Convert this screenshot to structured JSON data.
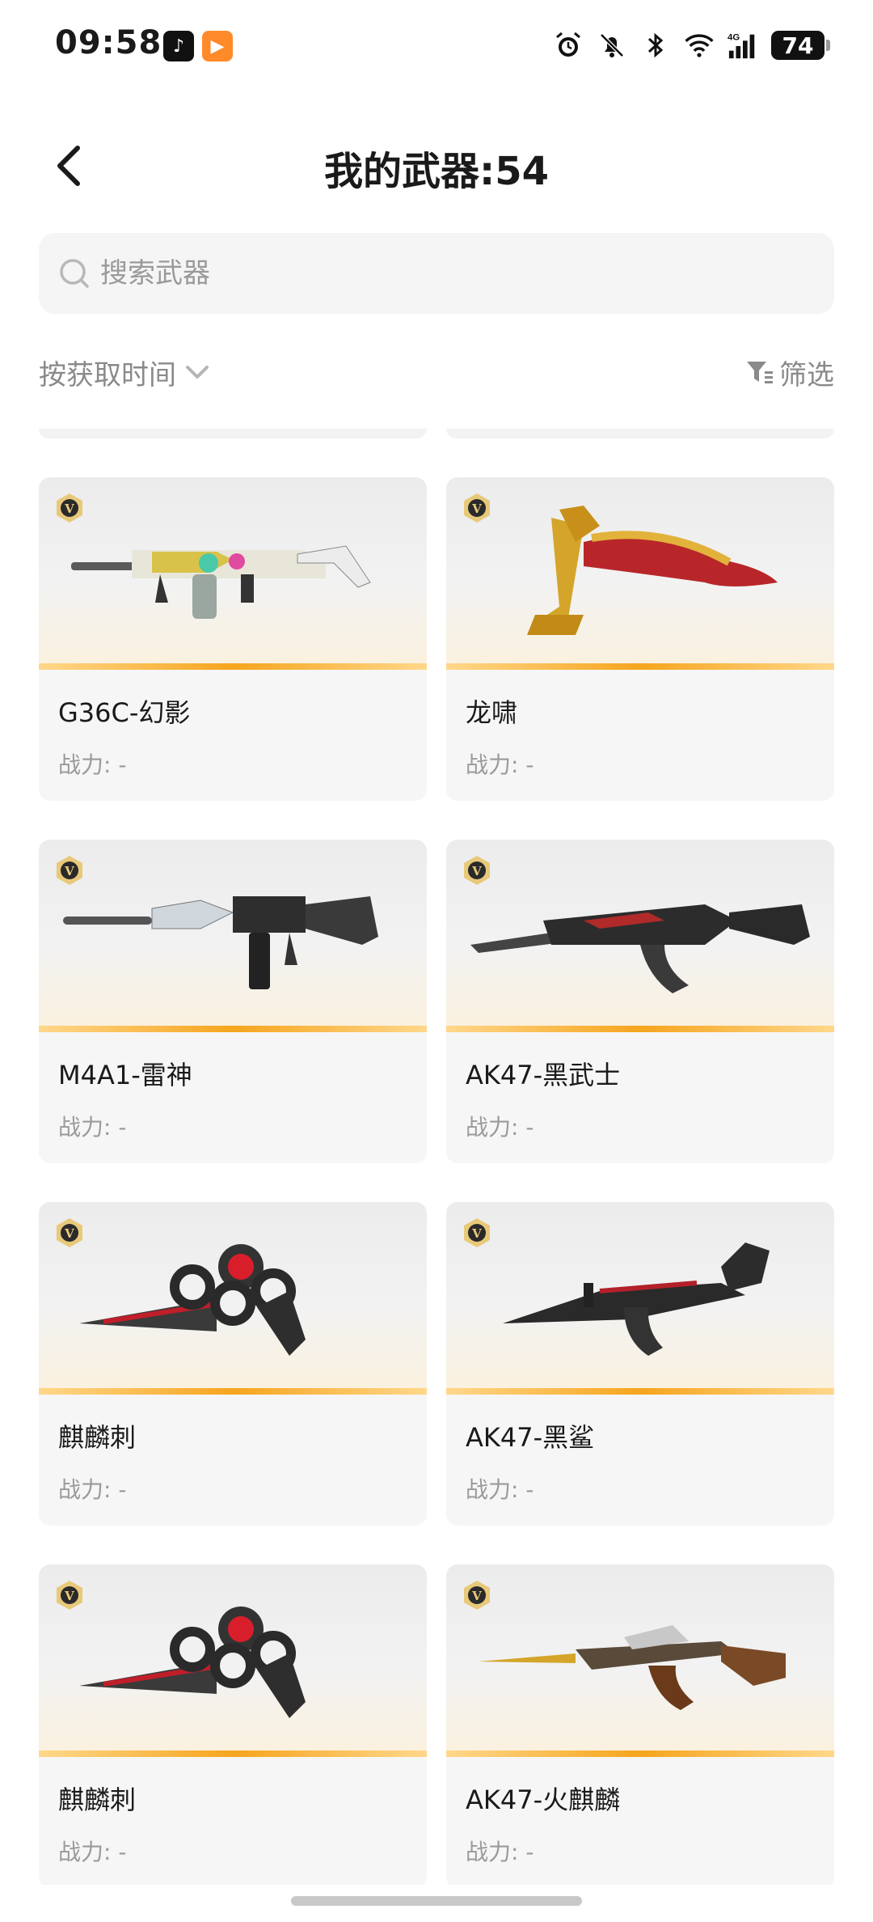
{
  "status_bar": {
    "time": "09:58",
    "battery": "74",
    "icons": [
      "tiktok-app-icon",
      "video-app-icon",
      "alarm-icon",
      "bell-muted-icon",
      "bluetooth-icon",
      "wifi-icon",
      "signal-4g-icon",
      "battery-icon"
    ]
  },
  "header": {
    "title": "我的武器:54"
  },
  "search": {
    "placeholder": "搜索武器"
  },
  "toolbar": {
    "sort_label": "按获取时间",
    "filter_label": "筛选"
  },
  "weapons": [
    {
      "name": "G36C-幻影",
      "power": "战力: -"
    },
    {
      "name": "龙啸",
      "power": "战力: -"
    },
    {
      "name": "M4A1-雷神",
      "power": "战力: -"
    },
    {
      "name": "AK47-黑武士",
      "power": "战力: -"
    },
    {
      "name": "麒麟刺",
      "power": "战力: -"
    },
    {
      "name": "AK47-黑鲨",
      "power": "战力: -"
    },
    {
      "name": "麒麟刺",
      "power": "战力: -"
    },
    {
      "name": "AK47-火麒麟",
      "power": "战力: -"
    }
  ],
  "colors": {
    "accent_bar": "#f6a51e",
    "badge": "#e8c97a"
  }
}
